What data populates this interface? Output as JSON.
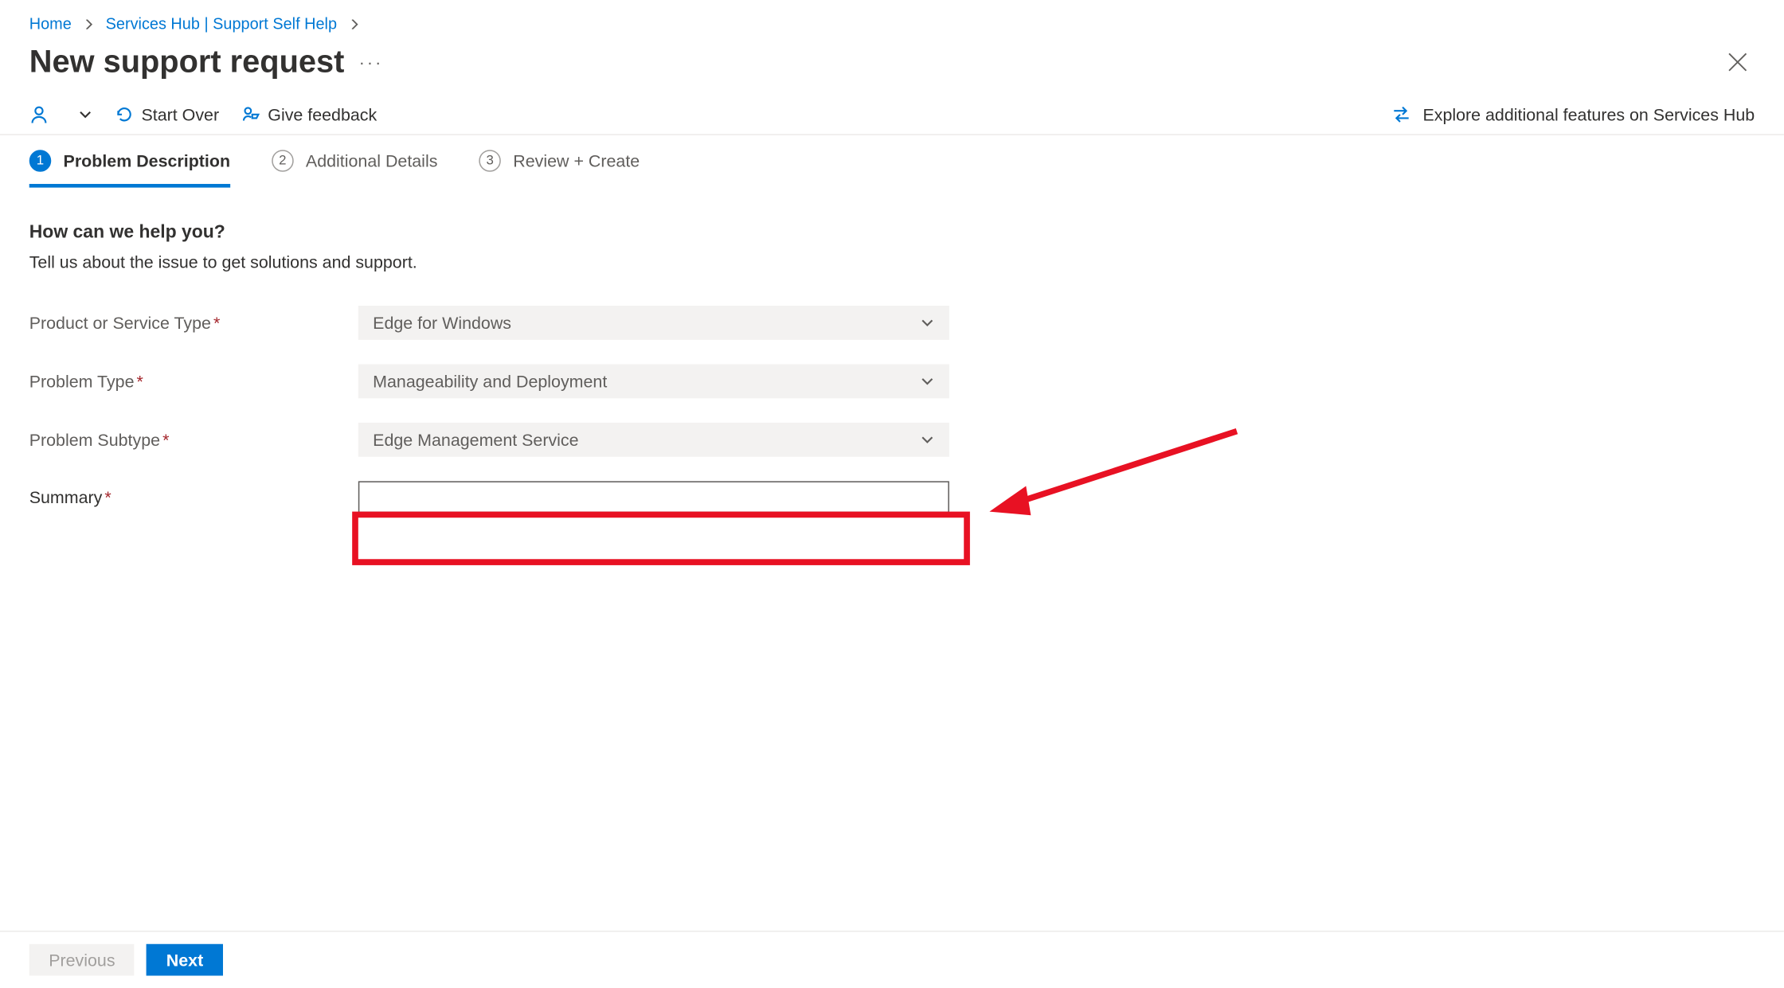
{
  "breadcrumb": {
    "home": "Home",
    "services_hub": "Services Hub | Support Self Help"
  },
  "title": "New support request",
  "commands": {
    "start_over": "Start Over",
    "give_feedback": "Give feedback",
    "explore": "Explore additional features on Services Hub"
  },
  "tabs": [
    {
      "num": "1",
      "label": "Problem Description"
    },
    {
      "num": "2",
      "label": "Additional Details"
    },
    {
      "num": "3",
      "label": "Review + Create"
    }
  ],
  "form": {
    "section_title": "How can we help you?",
    "section_sub": "Tell us about the issue to get solutions and support.",
    "fields": {
      "product_label": "Product or Service Type",
      "product_value": "Edge for Windows",
      "problem_type_label": "Problem Type",
      "problem_type_value": "Manageability and Deployment",
      "problem_subtype_label": "Problem Subtype",
      "problem_subtype_value": "Edge Management Service",
      "summary_label": "Summary",
      "summary_value": ""
    }
  },
  "footer": {
    "prev": "Previous",
    "next": "Next"
  }
}
